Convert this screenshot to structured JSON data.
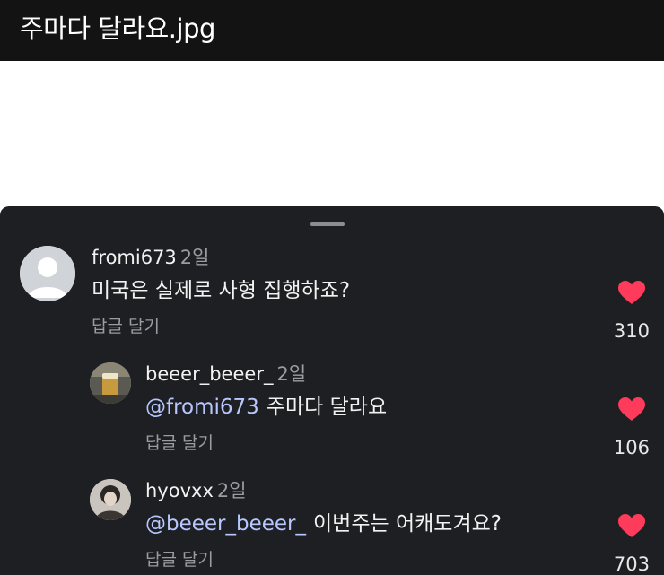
{
  "header": {
    "title": "주마다 달라요.jpg"
  },
  "colors": {
    "header_bg": "#131313",
    "sheet_bg": "#1e1f22",
    "mention": "#b8c8ff",
    "heart": "#ff3b5c",
    "muted": "#9a9ca1"
  },
  "comments": [
    {
      "username": "fromi673",
      "time": "2일",
      "mention": "",
      "text": "미국은 실제로 사형 집행하죠?",
      "reply_label": "답글 달기",
      "likes": "310",
      "avatar_icon": "default-avatar-icon",
      "like_icon": "heart-icon"
    },
    {
      "username": "beeer_beeer_",
      "time": "2일",
      "mention": "@fromi673",
      "text": "주마다 달라요",
      "reply_label": "답글 달기",
      "likes": "106",
      "avatar_icon": "profile-photo-icon",
      "like_icon": "heart-icon"
    },
    {
      "username": "hyovxx",
      "time": "2일",
      "mention": "@beeer_beeer_",
      "text": "이번주는 어캐도겨요?",
      "reply_label": "답글 달기",
      "likes": "703",
      "avatar_icon": "profile-photo-icon",
      "like_icon": "heart-icon"
    }
  ]
}
